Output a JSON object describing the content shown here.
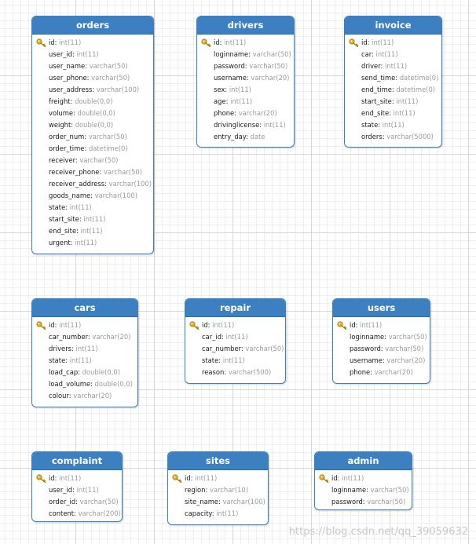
{
  "tables": {
    "orders": {
      "title": "orders",
      "fields": [
        {
          "name": "id",
          "type": "int(11)",
          "pk": true
        },
        {
          "name": "user_id",
          "type": "int(11)"
        },
        {
          "name": "user_name",
          "type": "varchar(50)"
        },
        {
          "name": "user_phone",
          "type": "varchar(50)"
        },
        {
          "name": "user_address",
          "type": "varchar(100)"
        },
        {
          "name": "freight",
          "type": "double(0,0)"
        },
        {
          "name": "volume",
          "type": "double(0,0)"
        },
        {
          "name": "weight",
          "type": "double(0,0)"
        },
        {
          "name": "order_num",
          "type": "varchar(50)"
        },
        {
          "name": "order_time",
          "type": "datetime(0)"
        },
        {
          "name": "receiver",
          "type": "varchar(50)"
        },
        {
          "name": "receiver_phone",
          "type": "varchar(50)"
        },
        {
          "name": "receiver_address",
          "type": "varchar(100)"
        },
        {
          "name": "goods_name",
          "type": "varchar(100)"
        },
        {
          "name": "state",
          "type": "int(11)"
        },
        {
          "name": "start_site",
          "type": "int(11)"
        },
        {
          "name": "end_site",
          "type": "int(11)"
        },
        {
          "name": "urgent",
          "type": "int(11)"
        }
      ]
    },
    "drivers": {
      "title": "drivers",
      "fields": [
        {
          "name": "id",
          "type": "int(11)",
          "pk": true
        },
        {
          "name": "loginname",
          "type": "varchar(50)"
        },
        {
          "name": "password",
          "type": "varchar(50)"
        },
        {
          "name": "username",
          "type": "varchar(20)"
        },
        {
          "name": "sex",
          "type": "int(11)"
        },
        {
          "name": "age",
          "type": "int(11)"
        },
        {
          "name": "phone",
          "type": "varchar(20)"
        },
        {
          "name": "drivinglicense",
          "type": "int(11)"
        },
        {
          "name": "entry_day",
          "type": "date"
        }
      ]
    },
    "invoice": {
      "title": "invoice",
      "fields": [
        {
          "name": "id",
          "type": "int(11)",
          "pk": true
        },
        {
          "name": "car",
          "type": "int(11)"
        },
        {
          "name": "driver",
          "type": "int(11)"
        },
        {
          "name": "send_time",
          "type": "datetime(0)"
        },
        {
          "name": "end_time",
          "type": "datetime(0)"
        },
        {
          "name": "start_site",
          "type": "int(11)"
        },
        {
          "name": "end_site",
          "type": "int(11)"
        },
        {
          "name": "state",
          "type": "int(11)"
        },
        {
          "name": "orders",
          "type": "varchar(5000)"
        }
      ]
    },
    "cars": {
      "title": "cars",
      "fields": [
        {
          "name": "id",
          "type": "int(11)",
          "pk": true
        },
        {
          "name": "car_number",
          "type": "varchar(20)"
        },
        {
          "name": "drivers",
          "type": "int(11)"
        },
        {
          "name": "state",
          "type": "int(11)"
        },
        {
          "name": "load_cap",
          "type": "double(0,0)"
        },
        {
          "name": "load_volume",
          "type": "double(0,0)"
        },
        {
          "name": "colour",
          "type": "varchar(20)"
        }
      ]
    },
    "repair": {
      "title": "repair",
      "fields": [
        {
          "name": "id",
          "type": "int(11)",
          "pk": true
        },
        {
          "name": "car_id",
          "type": "int(11)"
        },
        {
          "name": "car_number",
          "type": "varchar(50)"
        },
        {
          "name": "state",
          "type": "int(11)"
        },
        {
          "name": "reason",
          "type": "varchar(500)"
        }
      ]
    },
    "users": {
      "title": "users",
      "fields": [
        {
          "name": "id",
          "type": "int(11)",
          "pk": true
        },
        {
          "name": "loginname",
          "type": "varchar(50)"
        },
        {
          "name": "password",
          "type": "varchar(50)"
        },
        {
          "name": "username",
          "type": "varchar(20)"
        },
        {
          "name": "phone",
          "type": "varchar(20)"
        }
      ]
    },
    "complaint": {
      "title": "complaint",
      "fields": [
        {
          "name": "id",
          "type": "int(11)",
          "pk": true
        },
        {
          "name": "user_id",
          "type": "int(11)"
        },
        {
          "name": "order_id",
          "type": "varchar(50)"
        },
        {
          "name": "content",
          "type": "varchar(200)"
        }
      ]
    },
    "sites": {
      "title": "sites",
      "fields": [
        {
          "name": "id",
          "type": "int(11)",
          "pk": true
        },
        {
          "name": "region",
          "type": "varchar(10)"
        },
        {
          "name": "site_name",
          "type": "varchar(100)"
        },
        {
          "name": "capacity",
          "type": "int(11)"
        }
      ]
    },
    "admin": {
      "title": "admin",
      "fields": [
        {
          "name": "id",
          "type": "int(11)",
          "pk": true
        },
        {
          "name": "loginname",
          "type": "varchar(50)"
        },
        {
          "name": "password",
          "type": "varchar(50)"
        }
      ]
    }
  },
  "watermark": "https://blog.csdn.net/qq_39059632",
  "colors": {
    "header": "#3c80c2",
    "border": "#3c7fc1",
    "field_type": "#9a9a9a",
    "key_icon": "#e3b21c"
  }
}
